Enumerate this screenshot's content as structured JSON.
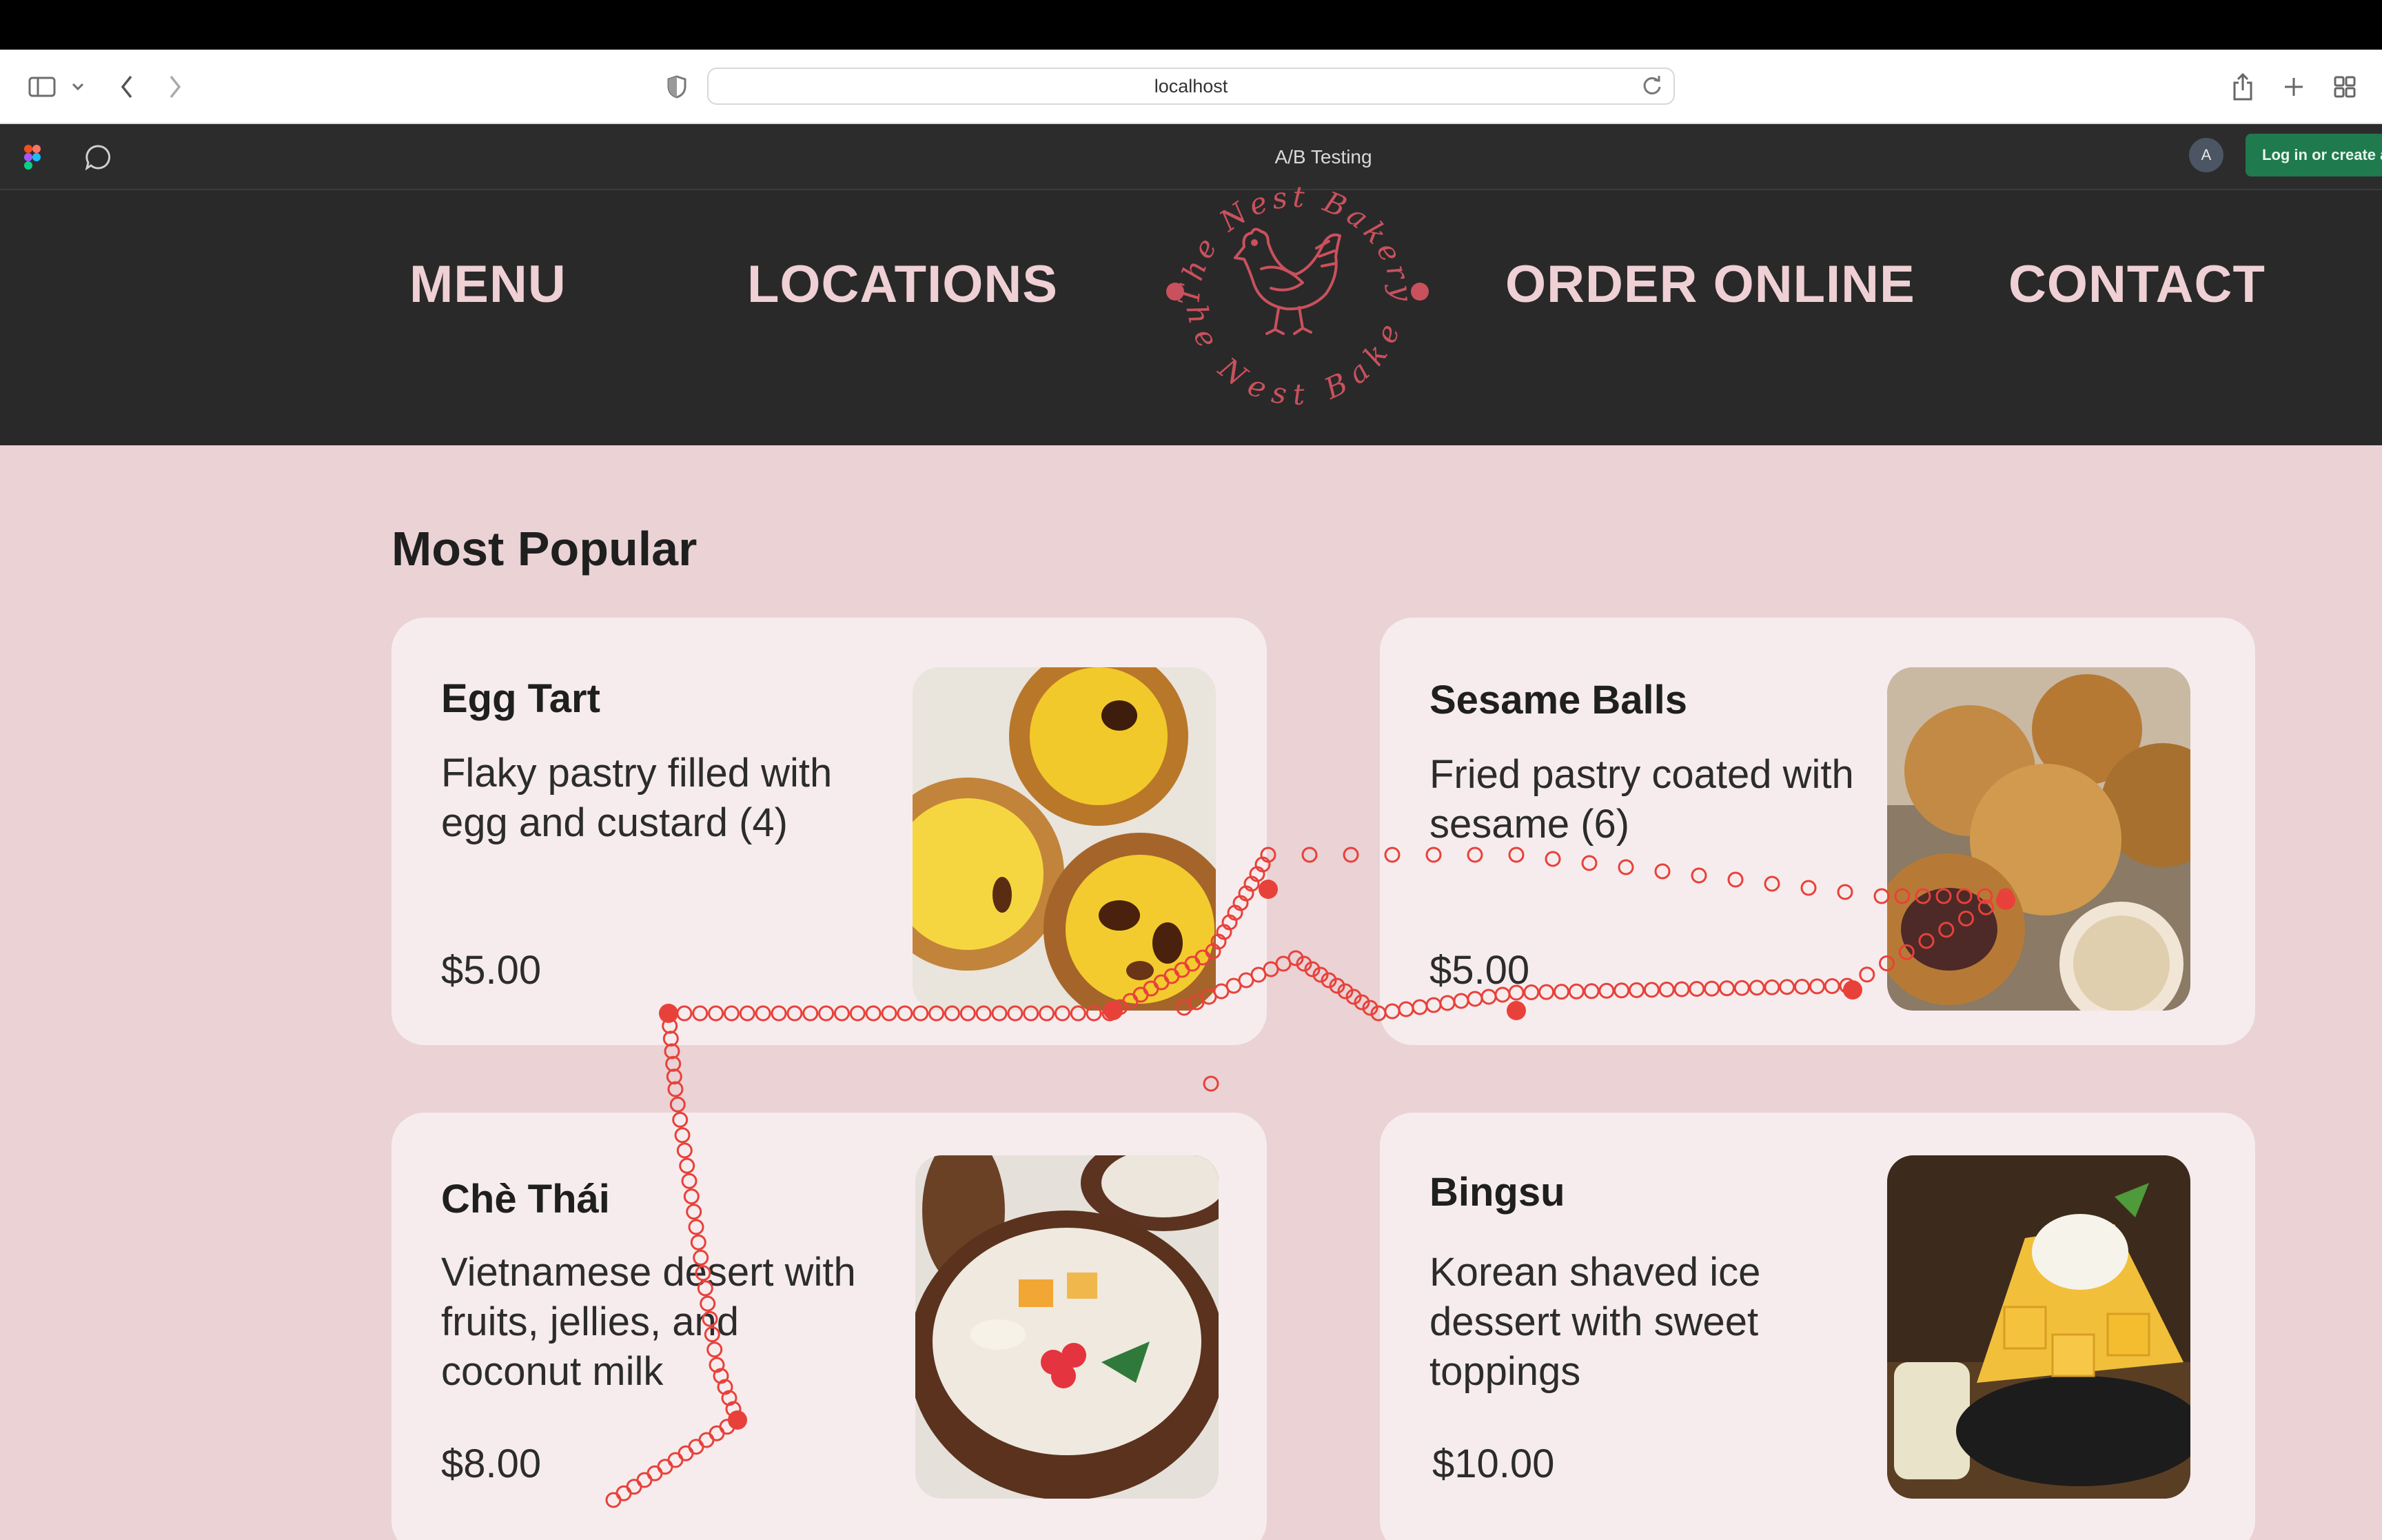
{
  "browser": {
    "url": "localhost",
    "icons": [
      "sidebar-icon",
      "chevron-down-icon",
      "back-icon",
      "forward-icon",
      "shield-icon",
      "reload-icon",
      "share-icon",
      "new-tab-icon",
      "tab-overview-icon"
    ]
  },
  "figma": {
    "title": "A/B Testing",
    "avatar_initial": "A",
    "login_label": "Log in or create a",
    "icons": [
      "figma-logo-icon",
      "comment-icon"
    ]
  },
  "nav": {
    "menu": "MENU",
    "locations": "LOCATIONS",
    "order_online": "ORDER ONLINE",
    "contact": "CONTACT",
    "logo_text_top": "The Nest Bakery",
    "logo_text_bottom": "The Nest Bakery"
  },
  "section": {
    "title": "Most Popular"
  },
  "items": [
    {
      "name": "Egg Tart",
      "description": "Flaky pastry filled with egg and custard (4)",
      "price": "$5.00"
    },
    {
      "name": "Sesame Balls",
      "description": "Fried pastry coated with sesame (6)",
      "price": "$5.00"
    },
    {
      "name": "Chè Thái",
      "description": "Vietnamese desert with fruits, jellies, and coconut milk",
      "price": "$8.00"
    },
    {
      "name": "Bingsu",
      "description": "Korean shaved ice dessert with sweet toppings",
      "price": "$10.00"
    }
  ],
  "colors": {
    "nav_bg": "#292929",
    "nav_text": "#efd0d4",
    "page_bg": "#ead2d5",
    "card_bg": "#f6eced",
    "logo": "#c9515d",
    "trail": "#e8413a",
    "login_bg": "#1f7a4d"
  }
}
